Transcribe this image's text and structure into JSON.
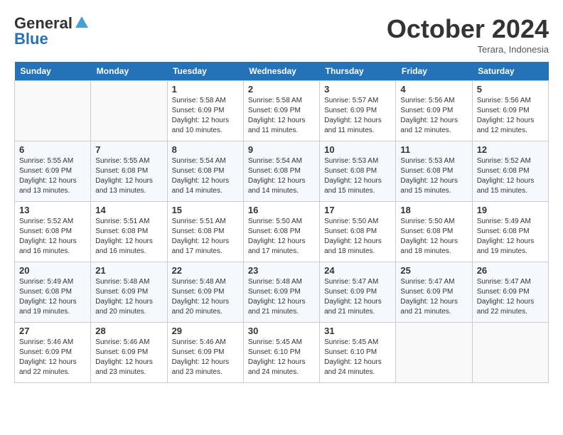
{
  "header": {
    "logo_general": "General",
    "logo_blue": "Blue",
    "month_title": "October 2024",
    "location": "Terara, Indonesia"
  },
  "weekdays": [
    "Sunday",
    "Monday",
    "Tuesday",
    "Wednesday",
    "Thursday",
    "Friday",
    "Saturday"
  ],
  "weeks": [
    [
      {
        "day": "",
        "info": ""
      },
      {
        "day": "",
        "info": ""
      },
      {
        "day": "1",
        "info": "Sunrise: 5:58 AM\nSunset: 6:09 PM\nDaylight: 12 hours\nand 10 minutes."
      },
      {
        "day": "2",
        "info": "Sunrise: 5:58 AM\nSunset: 6:09 PM\nDaylight: 12 hours\nand 11 minutes."
      },
      {
        "day": "3",
        "info": "Sunrise: 5:57 AM\nSunset: 6:09 PM\nDaylight: 12 hours\nand 11 minutes."
      },
      {
        "day": "4",
        "info": "Sunrise: 5:56 AM\nSunset: 6:09 PM\nDaylight: 12 hours\nand 12 minutes."
      },
      {
        "day": "5",
        "info": "Sunrise: 5:56 AM\nSunset: 6:09 PM\nDaylight: 12 hours\nand 12 minutes."
      }
    ],
    [
      {
        "day": "6",
        "info": "Sunrise: 5:55 AM\nSunset: 6:09 PM\nDaylight: 12 hours\nand 13 minutes."
      },
      {
        "day": "7",
        "info": "Sunrise: 5:55 AM\nSunset: 6:08 PM\nDaylight: 12 hours\nand 13 minutes."
      },
      {
        "day": "8",
        "info": "Sunrise: 5:54 AM\nSunset: 6:08 PM\nDaylight: 12 hours\nand 14 minutes."
      },
      {
        "day": "9",
        "info": "Sunrise: 5:54 AM\nSunset: 6:08 PM\nDaylight: 12 hours\nand 14 minutes."
      },
      {
        "day": "10",
        "info": "Sunrise: 5:53 AM\nSunset: 6:08 PM\nDaylight: 12 hours\nand 15 minutes."
      },
      {
        "day": "11",
        "info": "Sunrise: 5:53 AM\nSunset: 6:08 PM\nDaylight: 12 hours\nand 15 minutes."
      },
      {
        "day": "12",
        "info": "Sunrise: 5:52 AM\nSunset: 6:08 PM\nDaylight: 12 hours\nand 15 minutes."
      }
    ],
    [
      {
        "day": "13",
        "info": "Sunrise: 5:52 AM\nSunset: 6:08 PM\nDaylight: 12 hours\nand 16 minutes."
      },
      {
        "day": "14",
        "info": "Sunrise: 5:51 AM\nSunset: 6:08 PM\nDaylight: 12 hours\nand 16 minutes."
      },
      {
        "day": "15",
        "info": "Sunrise: 5:51 AM\nSunset: 6:08 PM\nDaylight: 12 hours\nand 17 minutes."
      },
      {
        "day": "16",
        "info": "Sunrise: 5:50 AM\nSunset: 6:08 PM\nDaylight: 12 hours\nand 17 minutes."
      },
      {
        "day": "17",
        "info": "Sunrise: 5:50 AM\nSunset: 6:08 PM\nDaylight: 12 hours\nand 18 minutes."
      },
      {
        "day": "18",
        "info": "Sunrise: 5:50 AM\nSunset: 6:08 PM\nDaylight: 12 hours\nand 18 minutes."
      },
      {
        "day": "19",
        "info": "Sunrise: 5:49 AM\nSunset: 6:08 PM\nDaylight: 12 hours\nand 19 minutes."
      }
    ],
    [
      {
        "day": "20",
        "info": "Sunrise: 5:49 AM\nSunset: 6:08 PM\nDaylight: 12 hours\nand 19 minutes."
      },
      {
        "day": "21",
        "info": "Sunrise: 5:48 AM\nSunset: 6:09 PM\nDaylight: 12 hours\nand 20 minutes."
      },
      {
        "day": "22",
        "info": "Sunrise: 5:48 AM\nSunset: 6:09 PM\nDaylight: 12 hours\nand 20 minutes."
      },
      {
        "day": "23",
        "info": "Sunrise: 5:48 AM\nSunset: 6:09 PM\nDaylight: 12 hours\nand 21 minutes."
      },
      {
        "day": "24",
        "info": "Sunrise: 5:47 AM\nSunset: 6:09 PM\nDaylight: 12 hours\nand 21 minutes."
      },
      {
        "day": "25",
        "info": "Sunrise: 5:47 AM\nSunset: 6:09 PM\nDaylight: 12 hours\nand 21 minutes."
      },
      {
        "day": "26",
        "info": "Sunrise: 5:47 AM\nSunset: 6:09 PM\nDaylight: 12 hours\nand 22 minutes."
      }
    ],
    [
      {
        "day": "27",
        "info": "Sunrise: 5:46 AM\nSunset: 6:09 PM\nDaylight: 12 hours\nand 22 minutes."
      },
      {
        "day": "28",
        "info": "Sunrise: 5:46 AM\nSunset: 6:09 PM\nDaylight: 12 hours\nand 23 minutes."
      },
      {
        "day": "29",
        "info": "Sunrise: 5:46 AM\nSunset: 6:09 PM\nDaylight: 12 hours\nand 23 minutes."
      },
      {
        "day": "30",
        "info": "Sunrise: 5:45 AM\nSunset: 6:10 PM\nDaylight: 12 hours\nand 24 minutes."
      },
      {
        "day": "31",
        "info": "Sunrise: 5:45 AM\nSunset: 6:10 PM\nDaylight: 12 hours\nand 24 minutes."
      },
      {
        "day": "",
        "info": ""
      },
      {
        "day": "",
        "info": ""
      }
    ]
  ]
}
